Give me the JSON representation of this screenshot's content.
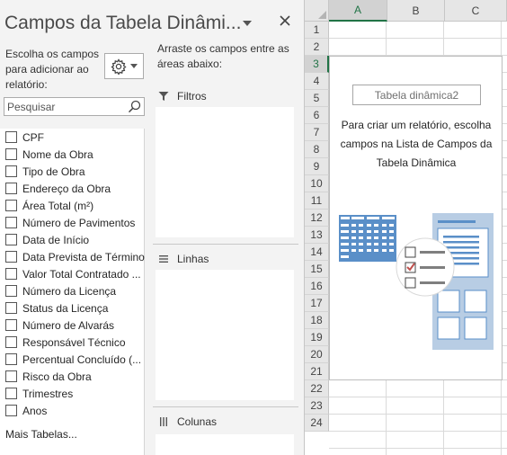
{
  "pane": {
    "title": "Campos da Tabela Dinâmi...",
    "choose_fields_label": "Escolha os campos para adicionar ao relatório:",
    "drag_fields_label": "Arraste os campos entre as áreas abaixo:",
    "search_placeholder": "Pesquisar",
    "fields": [
      {
        "label": "CPF",
        "checked": false
      },
      {
        "label": "Nome da Obra",
        "checked": false
      },
      {
        "label": "Tipo de Obra",
        "checked": false
      },
      {
        "label": "Endereço da Obra",
        "checked": false
      },
      {
        "label": "Área Total (m²)",
        "checked": false
      },
      {
        "label": "Número de Pavimentos",
        "checked": false
      },
      {
        "label": "Data de Início",
        "checked": false
      },
      {
        "label": "Data Prevista de Término",
        "checked": false
      },
      {
        "label": "Valor Total Contratado ...",
        "checked": false
      },
      {
        "label": "Número da Licença",
        "checked": false
      },
      {
        "label": "Status da Licença",
        "checked": false
      },
      {
        "label": "Número de Alvarás",
        "checked": false
      },
      {
        "label": "Responsável Técnico",
        "checked": false
      },
      {
        "label": "Percentual Concluído (...",
        "checked": false
      },
      {
        "label": "Risco da Obra",
        "checked": false
      },
      {
        "label": "Trimestres",
        "checked": false
      },
      {
        "label": "Anos",
        "checked": false
      }
    ],
    "more_tables": "Mais Tabelas...",
    "areas": {
      "filters": "Filtros",
      "rows": "Linhas",
      "columns": "Colunas"
    }
  },
  "sheet": {
    "columns": [
      "A",
      "B",
      "C"
    ],
    "active_column": "A",
    "rows": [
      "1",
      "2",
      "3",
      "4",
      "5",
      "6",
      "7",
      "8",
      "9",
      "10",
      "11",
      "12",
      "13",
      "14",
      "15",
      "16",
      "17",
      "18",
      "19",
      "20",
      "21",
      "22",
      "23",
      "24"
    ],
    "active_row": "3",
    "pivot": {
      "name": "Tabela dinâmica2",
      "instruction": "Para criar um relatório, escolha campos na Lista de Campos da Tabela Dinâmica"
    }
  },
  "colors": {
    "accent_green": "#217346",
    "illustration_blue": "#5a8fc8",
    "check_red": "#c0504d"
  }
}
